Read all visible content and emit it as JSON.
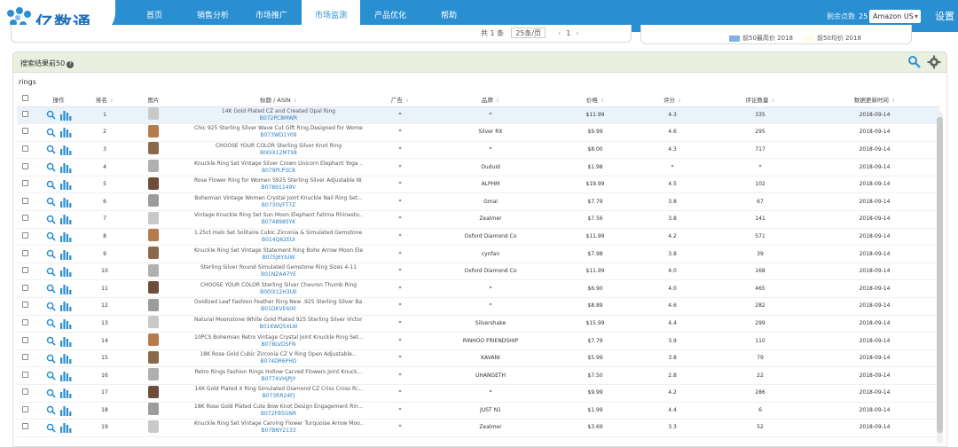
{
  "brand": {
    "name": "亿数通"
  },
  "nav": {
    "items": [
      {
        "label": "首页"
      },
      {
        "label": "销售分析"
      },
      {
        "label": "市场推广"
      },
      {
        "label": "市场监测"
      },
      {
        "label": "产品优化"
      },
      {
        "label": "帮助"
      }
    ],
    "active_index": 3
  },
  "header_right": {
    "remaining_label": "剩余点数",
    "flag_text": "25",
    "marketplace": "Amazon US",
    "settings_label": "设置"
  },
  "pager": {
    "total": "共 1 条",
    "per_page": "25条/页",
    "prev": "‹",
    "page": "1",
    "next": "›"
  },
  "legend": {
    "items": [
      {
        "label": "前50最高价 2018",
        "color": "#7fb0e8"
      },
      {
        "label": "前50均价 2018",
        "color": "#fffbe5"
      }
    ]
  },
  "panel": {
    "title": "搜索结果前50",
    "help_icon": "question-icon",
    "keyword": "rings"
  },
  "colors": {
    "brand": "#2a8fd1",
    "asin": "#2a7fc4",
    "row_highlight": "#eaf3fb",
    "panel_header": "#e9f0e0"
  },
  "table": {
    "columns": [
      "操作",
      "排名",
      "图片",
      "标题 / ASIN",
      "广告",
      "品牌",
      "价格",
      "评分",
      "评论数量",
      "数据更新时间"
    ],
    "rows": [
      {
        "rank": "1",
        "title": "14K Gold Plated CZ and Created Opal Ring",
        "asin": "B072PC8MWR",
        "ad": "*",
        "brand": "*",
        "price": "$11.99",
        "rating": "4.3",
        "reviews": "335",
        "updated": "2018-09-14"
      },
      {
        "rank": "2",
        "title": "Chic 925 Sterling Silver Wave Cut Gift Ring,Designed for Wome...",
        "asin": "B073WD1Y09",
        "ad": "*",
        "brand": "Silver RX",
        "price": "$9.99",
        "rating": "4.6",
        "reviews": "295",
        "updated": "2018-09-14"
      },
      {
        "rank": "3",
        "title": "CHOOSE YOUR COLOR Sterling Silver Knot Ring",
        "asin": "B00IX12MTS8",
        "ad": "*",
        "brand": "*",
        "price": "$8.00",
        "rating": "4.3",
        "reviews": "717",
        "updated": "2018-09-14"
      },
      {
        "rank": "4",
        "title": "Knuckle Ring Set Vintage Silver Crown Unicorn Elephant Yoga ...",
        "asin": "B079PLP3C8",
        "ad": "*",
        "brand": "Ouduid",
        "price": "$1.98",
        "rating": "*",
        "reviews": "*",
        "updated": "2018-09-14"
      },
      {
        "rank": "5",
        "title": "Rose Flower Ring for Women S925 Sterling Silver Adjustable W...",
        "asin": "B07891149V",
        "ad": "*",
        "brand": "ALPHM",
        "price": "$19.99",
        "rating": "4.5",
        "reviews": "102",
        "updated": "2018-09-14"
      },
      {
        "rank": "6",
        "title": "Bohemian Vintage Women Crystal Joint Knuckle Nail Ring Set...",
        "asin": "B0730VFT7Z",
        "ad": "*",
        "brand": "Gmai",
        "price": "$7.79",
        "rating": "3.8",
        "reviews": "67",
        "updated": "2018-09-14"
      },
      {
        "rank": "7",
        "title": "Vintage Knuckle Ring Set Sun Moon Elephant Fatima Rhinesto...",
        "asin": "B074898SYK",
        "ad": "*",
        "brand": "Zealmer",
        "price": "$7.56",
        "rating": "3.8",
        "reviews": "141",
        "updated": "2018-09-14"
      },
      {
        "rank": "8",
        "title": "1.25ct Halo Set Solitaire Cubic Zirconia & Simulated Gemstone...",
        "asin": "B014Q62EUI",
        "ad": "*",
        "brand": "Oxford Diamond Co",
        "price": "$11.99",
        "rating": "4.2",
        "reviews": "571",
        "updated": "2018-09-14"
      },
      {
        "rank": "9",
        "title": "Knuckle Ring Set Vintage Statement Ring Boho Arrow Moon Ele...",
        "asin": "B075J6YIUW",
        "ad": "*",
        "brand": "cynfan",
        "price": "$7.98",
        "rating": "3.8",
        "reviews": "39",
        "updated": "2018-09-14"
      },
      {
        "rank": "10",
        "title": "Sterling Silver Round Simulated Gemstone Ring Sizes 4-11",
        "asin": "B01NZAA7YE",
        "ad": "*",
        "brand": "Oxford Diamond Co",
        "price": "$11.99",
        "rating": "4.0",
        "reviews": "168",
        "updated": "2018-09-14"
      },
      {
        "rank": "11",
        "title": "CHOOSE YOUR COLOR Sterling Silver Chevron Thumb Ring",
        "asin": "B00IX12H3UE",
        "ad": "*",
        "brand": "*",
        "price": "$6.90",
        "rating": "4.0",
        "reviews": "465",
        "updated": "2018-09-14"
      },
      {
        "rank": "12",
        "title": "Oxidized Leaf Fashion Feather Ring New .925 Sterling Silver Ba...",
        "asin": "B01DKVE600",
        "ad": "*",
        "brand": "*",
        "price": "$8.89",
        "rating": "4.6",
        "reviews": "282",
        "updated": "2018-09-14"
      },
      {
        "rank": "13",
        "title": "Natural Moonstone White Gold Plated 925 Sterling Silver Victori...",
        "asin": "B01KWQ5XLW",
        "ad": "*",
        "brand": "Silvershake",
        "price": "$15.99",
        "rating": "4.4",
        "reviews": "299",
        "updated": "2018-09-14"
      },
      {
        "rank": "14",
        "title": "10PCS Bohemian Retro Vintage Crystal Joint Knuckle Ring Set...",
        "asin": "B078LVDSFN",
        "ad": "*",
        "brand": "RINHOO FRIENDSHIP",
        "price": "$7.79",
        "rating": "3.9",
        "reviews": "110",
        "updated": "2018-09-14"
      },
      {
        "rank": "15",
        "title": "18K Rose Gold Cubic Zirconia CZ V Ring Open Adjustable...",
        "asin": "B074DR6PHD",
        "ad": "*",
        "brand": "KAVANI",
        "price": "$5.99",
        "rating": "3.8",
        "reviews": "79",
        "updated": "2018-09-14"
      },
      {
        "rank": "16",
        "title": "Retro Rings Fashion Rings Hollow Carved Flowers Joint Knuck...",
        "asin": "B0774VHJPJY",
        "ad": "*",
        "brand": "UHANGETH",
        "price": "$7.50",
        "rating": "2.8",
        "reviews": "22",
        "updated": "2018-09-14"
      },
      {
        "rank": "17",
        "title": "14K Gold Plated X Ring Simulated Diamond CZ Criss Cross Ri...",
        "asin": "B073RR24FJ",
        "ad": "*",
        "brand": "*",
        "price": "$9.99",
        "rating": "4.2",
        "reviews": "286",
        "updated": "2018-09-14"
      },
      {
        "rank": "18",
        "title": "18K Rose Gold Plated Cute Bow Knot Design Engagement Rin...",
        "asin": "B072FB5GNR",
        "ad": "*",
        "brand": "JUST N1",
        "price": "$1.99",
        "rating": "4.4",
        "reviews": "6",
        "updated": "2018-09-14"
      },
      {
        "rank": "19",
        "title": "Knuckle Ring Set Vintage Carving Flower Turquoise Arrow Moo...",
        "asin": "B07BNY2133",
        "ad": "*",
        "brand": "Zealmer",
        "price": "$3.69",
        "rating": "3.3",
        "reviews": "52",
        "updated": "2018-09-14"
      }
    ]
  }
}
